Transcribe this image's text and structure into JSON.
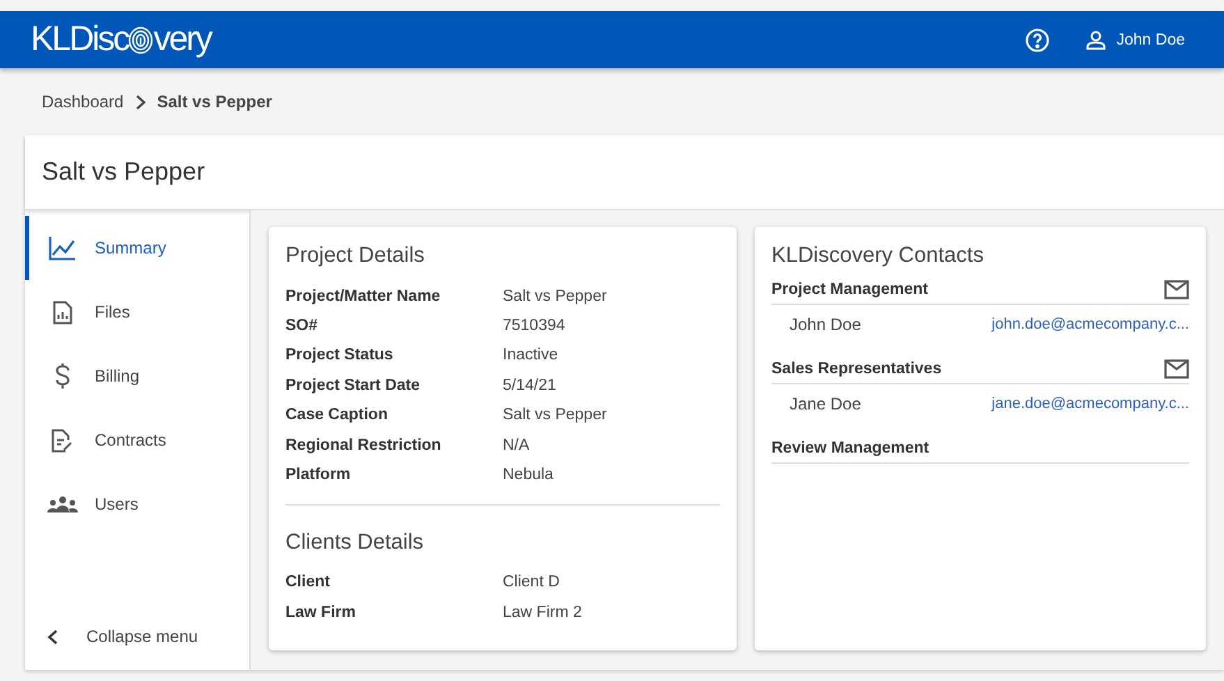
{
  "header": {
    "logo_start": "KLDisc",
    "logo_end": "very",
    "user": "John Doe"
  },
  "breadcrumb": [
    {
      "label": "Dashboard",
      "current": false
    },
    {
      "label": "Salt vs Pepper",
      "current": true
    }
  ],
  "page_title": "Salt vs Pepper",
  "sidebar": {
    "items": [
      {
        "label": "Summary",
        "kind": "chart",
        "selected": true
      },
      {
        "label": "Files",
        "kind": "file",
        "selected": false
      },
      {
        "label": "Billing",
        "kind": "dollar",
        "selected": false
      },
      {
        "label": "Contracts",
        "kind": "contract",
        "selected": false
      },
      {
        "label": "Users",
        "kind": "users",
        "selected": false
      }
    ],
    "collapse": "Collapse menu"
  },
  "project_details": {
    "title": "Project Details",
    "rows": [
      {
        "label": "Project/Matter Name",
        "value": "Salt vs Pepper"
      },
      {
        "label": "SO#",
        "value": "7510394"
      },
      {
        "label": "Project Status",
        "value": "Inactive"
      },
      {
        "label": "Project Start Date",
        "value": "5/14/21"
      },
      {
        "label": "Case Caption",
        "value": "Salt vs Pepper"
      },
      {
        "label": "Regional Restriction",
        "value": "N/A"
      },
      {
        "label": "Platform",
        "value": "Nebula"
      }
    ]
  },
  "clients_details": {
    "title": "Clients Details",
    "rows": [
      {
        "label": "Client",
        "value": "Client D"
      },
      {
        "label": "Law Firm",
        "value": "Law Firm 2"
      }
    ]
  },
  "contacts": {
    "title": "KLDiscovery Contacts",
    "groups": [
      {
        "name": "Project Management",
        "mail": true,
        "people": [
          {
            "name": "John Doe",
            "email": "john.doe@acmecompany.c..."
          }
        ]
      },
      {
        "name": "Sales Representatives",
        "mail": true,
        "people": [
          {
            "name": "Jane Doe",
            "email": "jane.doe@acmecompany.c..."
          }
        ]
      },
      {
        "name": "Review Management",
        "mail": false
      }
    ]
  }
}
